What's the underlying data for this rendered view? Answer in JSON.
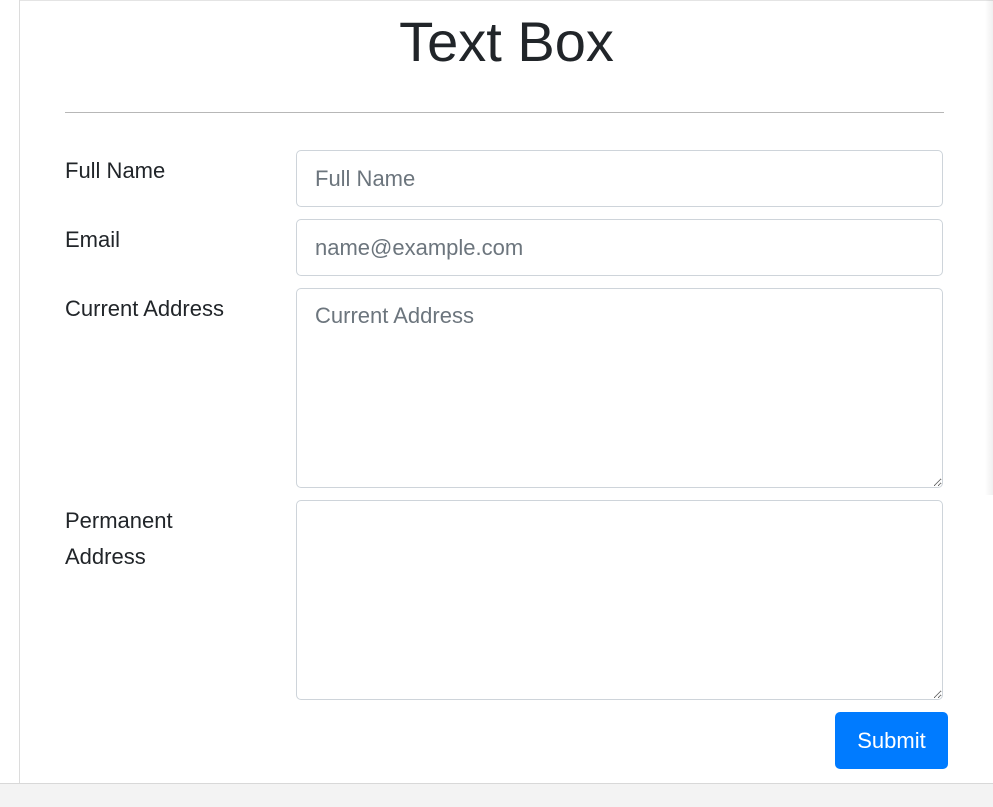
{
  "page": {
    "title": "Text Box"
  },
  "form": {
    "full_name": {
      "label": "Full Name",
      "value": "",
      "placeholder": "Full Name"
    },
    "email": {
      "label": "Email",
      "value": "",
      "placeholder": "name@example.com"
    },
    "current_address": {
      "label": "Current Address",
      "value": "",
      "placeholder": "Current Address"
    },
    "permanent_address": {
      "label": "Permanent Address",
      "value": "",
      "placeholder": ""
    },
    "submit_label": "Submit"
  },
  "colors": {
    "submit_button": "#007bff",
    "input_border": "#ced4da",
    "placeholder": "#6c757d",
    "text": "#212529"
  },
  "icons": {
    "textarea_resize": "resize-handle-icon"
  }
}
